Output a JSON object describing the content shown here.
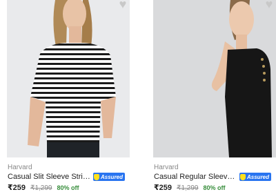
{
  "products": [
    {
      "brand": "Harvard",
      "title": "Casual Slit Sleeve Striped ...",
      "assured_label": "Assured",
      "price": "₹259",
      "mrp": "₹1,299",
      "discount": "80% off",
      "wishlist_icon": "heart-icon"
    },
    {
      "brand": "Harvard",
      "title": "Casual Regular Sleeve Solid...",
      "assured_label": "Assured",
      "price": "₹259",
      "mrp": "₹1,299",
      "discount": "80% off",
      "wishlist_icon": "heart-icon"
    }
  ],
  "colors": {
    "assured_blue": "#2874f0",
    "discount_green": "#388e3c",
    "muted_gray": "#878787"
  }
}
